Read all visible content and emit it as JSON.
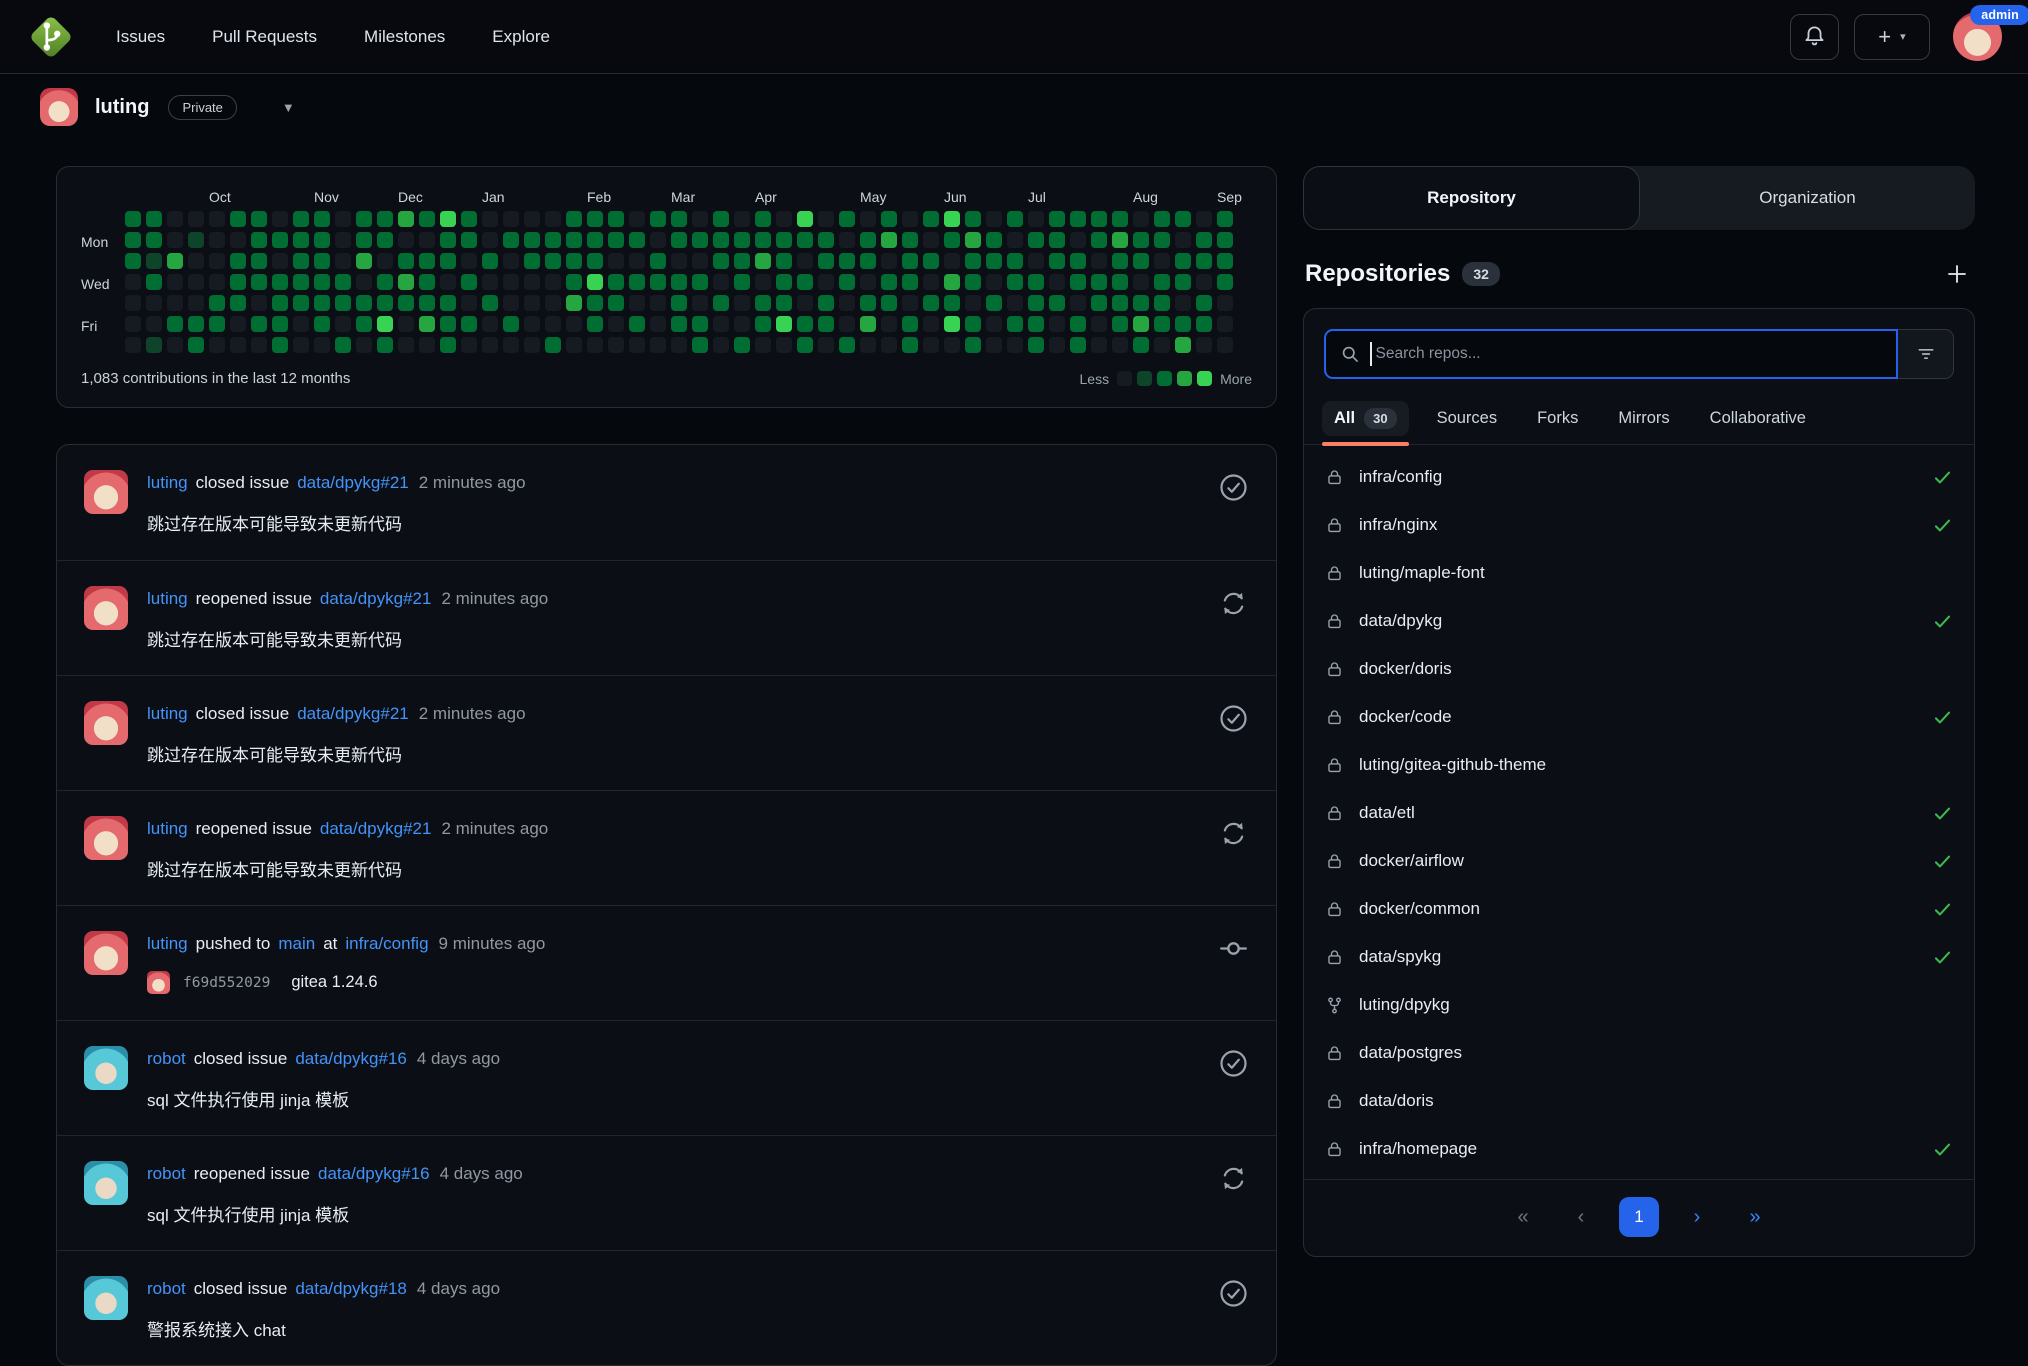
{
  "navbar": {
    "logo": "gitea-logo",
    "links": [
      "Issues",
      "Pull Requests",
      "Milestones",
      "Explore"
    ],
    "admin_badge": "admin"
  },
  "profile_header": {
    "username": "luting",
    "visibility_badge": "Private"
  },
  "chart_data": {
    "type": "heatmap",
    "title": "1,083 contributions in the last 12 months",
    "legend_less": "Less",
    "legend_more": "More",
    "day_labels": [
      "",
      "Mon",
      "",
      "Wed",
      "",
      "Fri",
      ""
    ],
    "months": [
      {
        "label": "Oct",
        "col": 4
      },
      {
        "label": "Nov",
        "col": 9
      },
      {
        "label": "Dec",
        "col": 13
      },
      {
        "label": "Jan",
        "col": 17
      },
      {
        "label": "Feb",
        "col": 22
      },
      {
        "label": "Mar",
        "col": 26
      },
      {
        "label": "Apr",
        "col": 30
      },
      {
        "label": "May",
        "col": 35
      },
      {
        "label": "Jun",
        "col": 39
      },
      {
        "label": "Jul",
        "col": 43
      },
      {
        "label": "Aug",
        "col": 48
      },
      {
        "label": "Sep",
        "col": 52
      }
    ],
    "level_colors": [
      "#161b22",
      "#0e4429",
      "#006d32",
      "#26a641",
      "#39d353"
    ],
    "weeks": [
      "2220000",
      "2212001",
      "0030020",
      "0100022",
      "0000220",
      "2022200",
      "2222020",
      "0202222",
      "2222200",
      "2222220",
      "0002202",
      "2230220",
      "2202242",
      "3023200",
      "2022230",
      "4220222",
      "2202020",
      "0020200",
      "0200020",
      "0220000",
      "0220002",
      "2222300",
      "2224220",
      "2202200",
      "0202020",
      "2022000",
      "2202220",
      "0202022",
      "2220200",
      "0222002",
      "2230220",
      "0222240",
      "4202022",
      "0220220",
      "2022002",
      "0220230",
      "2302200",
      "0222022",
      "2020200",
      "4203240",
      "2322022",
      "0220200",
      "2022020",
      "0202222",
      "2220200",
      "2022022",
      "2202200",
      "2322220",
      "0220232",
      "2202220",
      "2022023",
      "0220220",
      "2222000"
    ]
  },
  "feed": {
    "items": [
      {
        "avatar": "luting",
        "user": "luting",
        "action": "closed issue",
        "target": "data/dpykg#21",
        "time": "2 minutes ago",
        "body": "跳过存在版本可能导致未更新代码",
        "icon": "check"
      },
      {
        "avatar": "luting",
        "user": "luting",
        "action": "reopened issue",
        "target": "data/dpykg#21",
        "time": "2 minutes ago",
        "body": "跳过存在版本可能导致未更新代码",
        "icon": "reopen"
      },
      {
        "avatar": "luting",
        "user": "luting",
        "action": "closed issue",
        "target": "data/dpykg#21",
        "time": "2 minutes ago",
        "body": "跳过存在版本可能导致未更新代码",
        "icon": "check"
      },
      {
        "avatar": "luting",
        "user": "luting",
        "action": "reopened issue",
        "target": "data/dpykg#21",
        "time": "2 minutes ago",
        "body": "跳过存在版本可能导致未更新代码",
        "icon": "reopen"
      },
      {
        "avatar": "luting",
        "user": "luting",
        "action": "pushed to",
        "branch": "main",
        "joiner": "at",
        "target": "infra/config",
        "time": "9 minutes ago",
        "icon": "commit",
        "commit": {
          "hash": "f69d552029",
          "message": "gitea 1.24.6"
        }
      },
      {
        "avatar": "robot",
        "user": "robot",
        "action": "closed issue",
        "target": "data/dpykg#16",
        "time": "4 days ago",
        "body": "sql 文件执行使用 jinja 模板",
        "icon": "check"
      },
      {
        "avatar": "robot",
        "user": "robot",
        "action": "reopened issue",
        "target": "data/dpykg#16",
        "time": "4 days ago",
        "body": "sql 文件执行使用 jinja 模板",
        "icon": "reopen"
      },
      {
        "avatar": "robot",
        "user": "robot",
        "action": "closed issue",
        "target": "data/dpykg#18",
        "time": "4 days ago",
        "body": "警报系统接入 chat",
        "icon": "check"
      }
    ]
  },
  "sidebar": {
    "tabs": [
      {
        "label": "Repository",
        "active": true
      },
      {
        "label": "Organization",
        "active": false
      }
    ],
    "heading": "Repositories",
    "count": "32",
    "search": {
      "placeholder": "Search repos..."
    },
    "filters": [
      {
        "label": "All",
        "count": "30",
        "active": true
      },
      {
        "label": "Sources",
        "active": false
      },
      {
        "label": "Forks",
        "active": false
      },
      {
        "label": "Mirrors",
        "active": false
      },
      {
        "label": "Collaborative",
        "active": false
      }
    ],
    "repos": [
      {
        "name": "infra/config",
        "icon": "lock",
        "check": true
      },
      {
        "name": "infra/nginx",
        "icon": "lock",
        "check": true
      },
      {
        "name": "luting/maple-font",
        "icon": "lock",
        "check": false
      },
      {
        "name": "data/dpykg",
        "icon": "lock",
        "check": true
      },
      {
        "name": "docker/doris",
        "icon": "lock",
        "check": false
      },
      {
        "name": "docker/code",
        "icon": "lock",
        "check": true
      },
      {
        "name": "luting/gitea-github-theme",
        "icon": "lock",
        "check": false
      },
      {
        "name": "data/etl",
        "icon": "lock",
        "check": true
      },
      {
        "name": "docker/airflow",
        "icon": "lock",
        "check": true
      },
      {
        "name": "docker/common",
        "icon": "lock",
        "check": true
      },
      {
        "name": "data/spykg",
        "icon": "lock",
        "check": true
      },
      {
        "name": "luting/dpykg",
        "icon": "fork",
        "check": false
      },
      {
        "name": "data/postgres",
        "icon": "lock",
        "check": false
      },
      {
        "name": "data/doris",
        "icon": "lock",
        "check": false
      },
      {
        "name": "infra/homepage",
        "icon": "lock",
        "check": true
      }
    ],
    "pagination": [
      {
        "label": "«",
        "state": "disabled"
      },
      {
        "label": "‹",
        "state": "disabled"
      },
      {
        "label": "1",
        "state": "active"
      },
      {
        "label": "›",
        "state": "link"
      },
      {
        "label": "»",
        "state": "link"
      }
    ]
  }
}
